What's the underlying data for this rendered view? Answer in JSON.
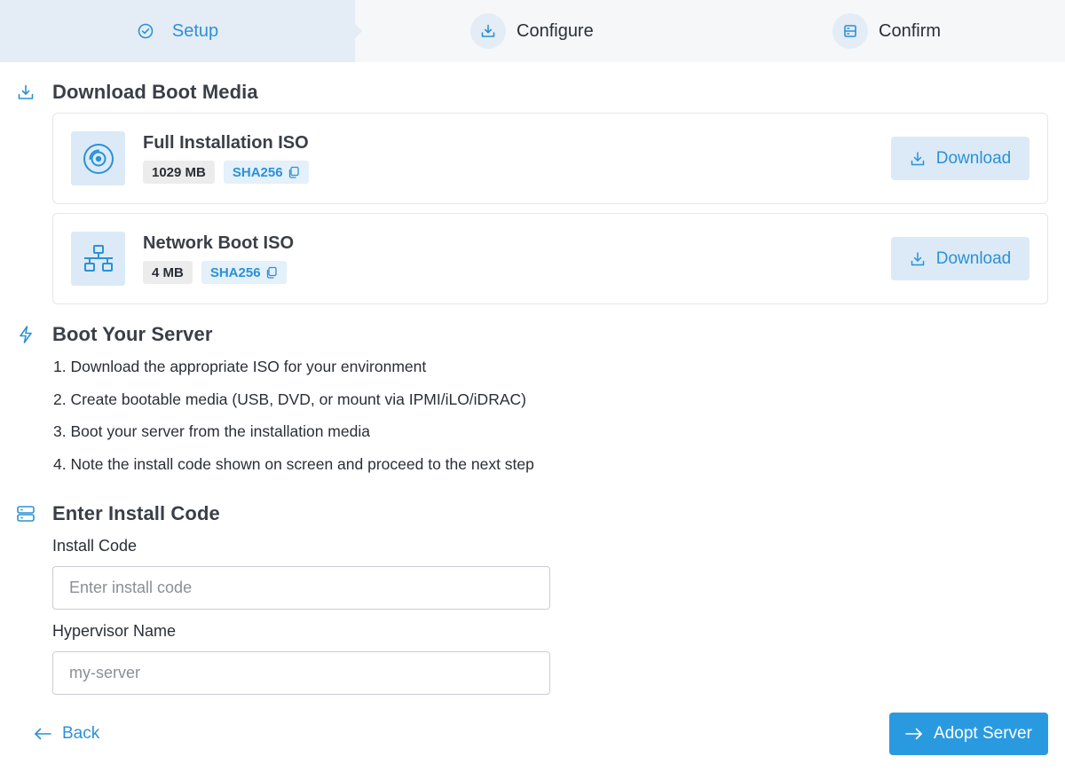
{
  "stepper": {
    "steps": [
      {
        "label": "Setup",
        "icon": "check-circle-icon",
        "state": "active"
      },
      {
        "label": "Configure",
        "icon": "download-tray-icon",
        "state": "inactive"
      },
      {
        "label": "Confirm",
        "icon": "server-icon",
        "state": "inactive"
      }
    ]
  },
  "download_section": {
    "title": "Download Boot Media",
    "icon": "download-tray-icon",
    "items": [
      {
        "name": "Full Installation ISO",
        "icon": "disc-icon",
        "size": "1029 MB",
        "hash_label": "SHA256",
        "button_label": "Download"
      },
      {
        "name": "Network Boot ISO",
        "icon": "network-icon",
        "size": "4 MB",
        "hash_label": "SHA256",
        "button_label": "Download"
      }
    ]
  },
  "boot_section": {
    "title": "Boot Your Server",
    "icon": "lightning-icon",
    "steps": [
      "1. Download the appropriate ISO for your environment",
      "2. Create bootable media (USB, DVD, or mount via IPMI/iLO/iDRAC)",
      "3. Boot your server from the installation media",
      "4. Note the install code shown on screen and proceed to the next step"
    ]
  },
  "install_section": {
    "title": "Enter Install Code",
    "icon": "server-icon",
    "install_code": {
      "label": "Install Code",
      "value": "",
      "placeholder": "Enter install code"
    },
    "hypervisor_name": {
      "label": "Hypervisor Name",
      "value": "",
      "placeholder": "my-server"
    }
  },
  "footer": {
    "back_label": "Back",
    "adopt_label": "Adopt Server"
  },
  "colors": {
    "accent": "#2b91d6",
    "primary_button": "#2a9ae0",
    "accent_light": "#dbeaf6",
    "stepper_active_bg": "#e4ecf5",
    "text": "#3a3f47"
  }
}
